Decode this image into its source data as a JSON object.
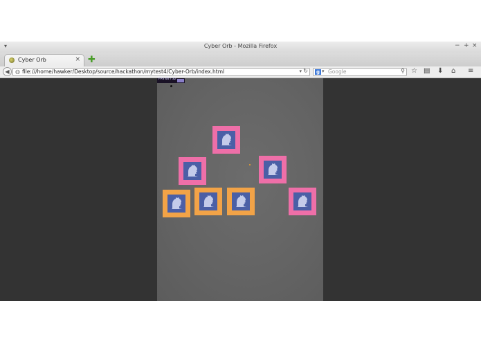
{
  "window": {
    "title": "Cyber Orb - Mozilla Firefox",
    "controls": {
      "minimize": "−",
      "maximize": "+",
      "close": "×"
    },
    "menu_glyph": "▾"
  },
  "tab": {
    "label": "Cyber Orb",
    "close": "×",
    "new_tab": "✚"
  },
  "navbar": {
    "back": "◀",
    "url": "file:///home/hawker/Desktop/source/hackathon/mytest4/Cyber-Orb/index.html",
    "url_dropdown": "▾",
    "reload": "↻",
    "search_placeholder": "Google",
    "search_engine": "g",
    "search_dropdown": "▾",
    "search_icon": "⚲",
    "tools": {
      "bookmark_star": "☆",
      "bookmarks_list": "▤",
      "downloads": "⬇",
      "home": "⌂",
      "menu": "≡"
    }
  },
  "overlay": {
    "fps_text": "FPS 60 / 32"
  },
  "notes": [
    {
      "color": "pink",
      "icon": "dinosaur-marker"
    },
    {
      "color": "pink",
      "icon": "dinosaur-marker"
    },
    {
      "color": "pink",
      "icon": "dinosaur-marker"
    },
    {
      "color": "orange",
      "icon": "dinosaur-marker"
    },
    {
      "color": "orange",
      "icon": "dinosaur-marker"
    },
    {
      "color": "orange",
      "icon": "dinosaur-marker"
    },
    {
      "color": "pink",
      "icon": "dinosaur-marker"
    }
  ],
  "colors": {
    "pink": "#ee6fa8",
    "orange": "#f2a347",
    "marker_blue": "#4b5fa6",
    "marker_figure": "#c4cbea"
  }
}
